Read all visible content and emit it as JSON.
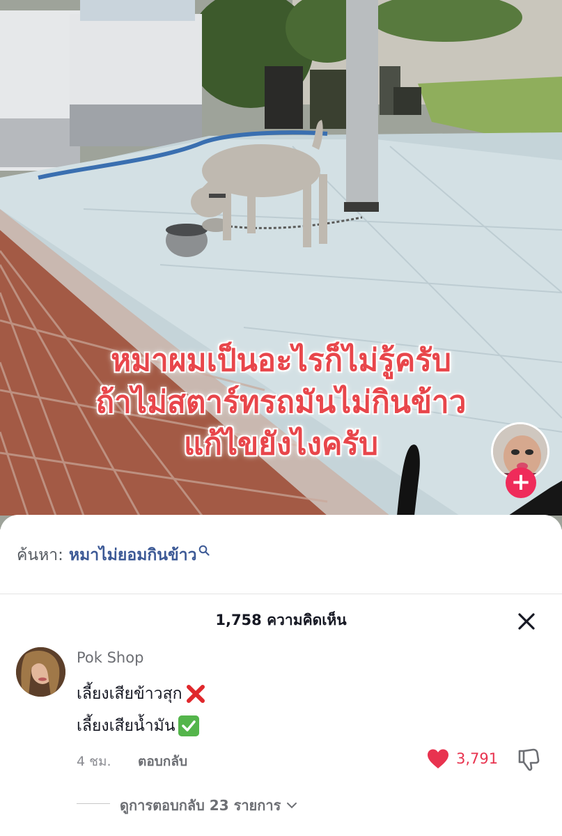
{
  "video": {
    "caption_lines": [
      "หมาผมเป็นอะไรก็ไม่รู้ครับ",
      "ถ้าไม่สตาร์ทรถมันไม่กินข้าว",
      "แก้ไขยังไงครับ"
    ],
    "follow_symbol": "+"
  },
  "search": {
    "prefix": "ค้นหา:",
    "query": "หมาไม่ยอมกินข้าว",
    "icon": "search-icon"
  },
  "comments_header": {
    "title": "1,758 ความคิดเห็น",
    "close_icon": "close-icon"
  },
  "comment": {
    "username": "Pok Shop",
    "line1": "เลี้ยงเสียข้าวสุก",
    "line1_emoji": "cross-mark",
    "line2": "เลี้ยงเสียน้ำมัน",
    "line2_emoji": "check-mark",
    "time": "4 ชม.",
    "reply_label": "ตอบกลับ",
    "like_count": "3,791",
    "view_replies": "ดูการตอบกลับ 23 รายการ"
  },
  "colors": {
    "caption": "#e8464b",
    "like": "#e8334f",
    "search_query": "#3d5a96",
    "follow": "#ef2b5a"
  }
}
